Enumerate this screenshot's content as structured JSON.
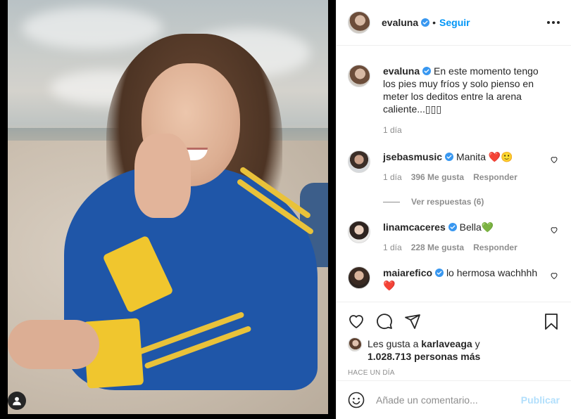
{
  "post": {
    "author": "evaluna",
    "follow_label": "Seguir",
    "separator": "•"
  },
  "caption": {
    "username": "evaluna",
    "text": "En este momento tengo los pies muy fríos y solo pienso en meter los deditos entre la arena caliente...▯▯▯",
    "time": "1 día"
  },
  "comments": [
    {
      "username": "jsebasmusic",
      "text": "Manita ❤️🙂",
      "time": "1 día",
      "likes": "396 Me gusta",
      "reply_label": "Responder",
      "replies_label": "Ver respuestas (6)"
    },
    {
      "username": "linamcaceres",
      "text": "Bella💚",
      "time": "1 día",
      "likes": "228 Me gusta",
      "reply_label": "Responder"
    },
    {
      "username": "maiarefico",
      "text": "lo hermosa wachhhh❤️"
    }
  ],
  "likes": {
    "prefix": "Les gusta a",
    "user": "karlaveaga",
    "connector": "y",
    "others": "1.028.713 personas más"
  },
  "post_time": "HACE UN DÍA",
  "comment_box": {
    "placeholder": "Añade un comentario...",
    "publish_label": "Publicar"
  },
  "colors": {
    "link_blue": "#0095f6",
    "verified_blue": "#3897f0",
    "publish_disabled": "#b2dffc",
    "muted_text": "#8e8e8e"
  },
  "icons": {
    "header": [
      "verified-badge-icon",
      "more-options-icon"
    ],
    "actions": [
      "heart-icon",
      "comment-icon",
      "share-icon",
      "bookmark-icon"
    ],
    "other": [
      "tag-user-icon",
      "emoji-icon",
      "small-heart-icon"
    ]
  }
}
